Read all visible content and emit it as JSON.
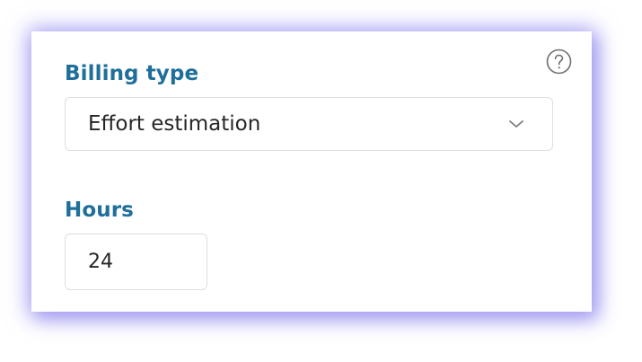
{
  "help": {
    "icon": "question-circle-icon"
  },
  "billing_type": {
    "label": "Billing type",
    "selected_value": "Effort estimation",
    "icon": "chevron-down-icon"
  },
  "hours": {
    "label": "Hours",
    "value": "24"
  },
  "colors": {
    "label": "#1f6f9a",
    "text": "#262626",
    "border": "#dedede",
    "glow": "#786ef0"
  }
}
